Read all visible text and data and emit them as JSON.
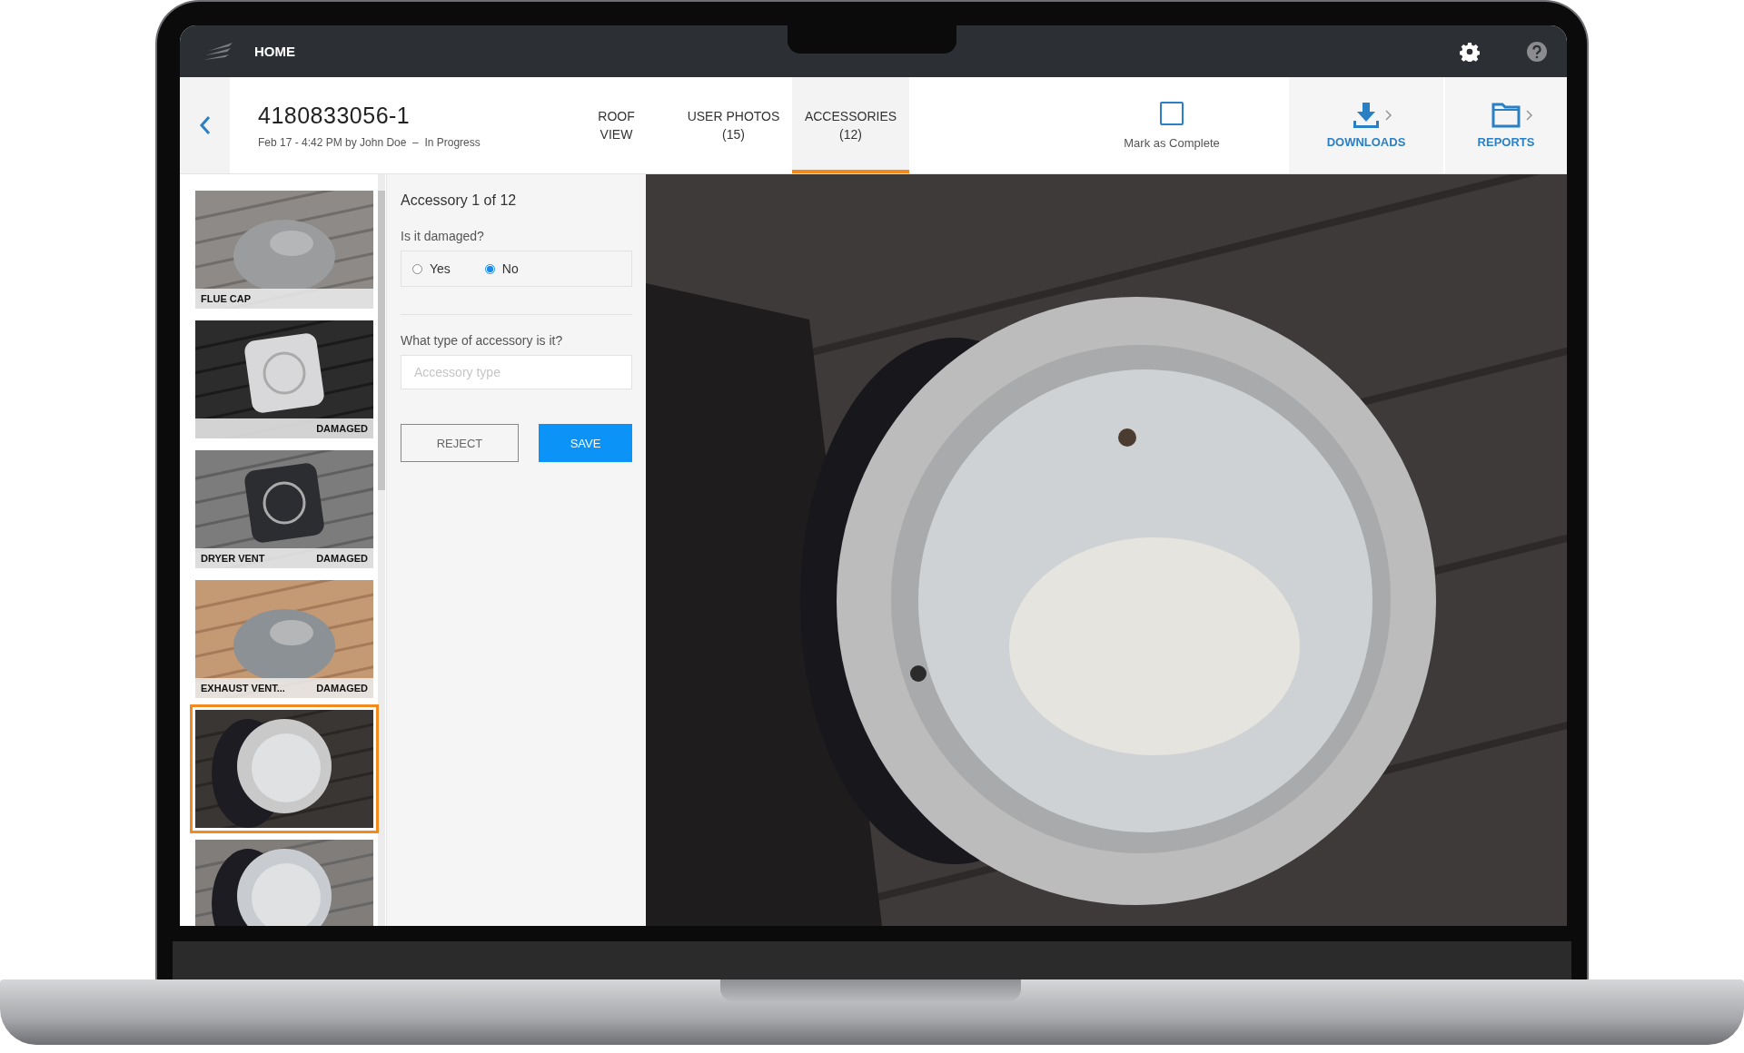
{
  "top_bar": {
    "title": "HOME"
  },
  "header": {
    "title": "4180833056-1",
    "subtitle": "Feb 17 - 4:42 PM by John Doe  –  In Progress",
    "tabs": [
      {
        "label": "ROOF",
        "label2": "VIEW",
        "selected": false
      },
      {
        "label": "USER PHOTOS",
        "label2": "(15)",
        "selected": false
      },
      {
        "label": "ACCESSORIES",
        "label2": "(12)",
        "selected": true
      }
    ],
    "mark_complete": {
      "label": "Mark as Complete",
      "checked": false
    },
    "actions": [
      {
        "label": "DOWNLOADS",
        "kind": "download"
      },
      {
        "label": "REPORTS",
        "kind": "folder"
      }
    ]
  },
  "thumbnails": [
    {
      "label": "FLUE CAP",
      "selected": false,
      "kind": "dome"
    },
    {
      "status": "DAMAGED",
      "selected": false,
      "kind": "square"
    },
    {
      "label": "DRYER VENT",
      "status": "DAMAGED",
      "selected": false,
      "kind": "box"
    },
    {
      "label": "EXHAUST VENT...",
      "status": "DAMAGED",
      "selected": false,
      "kind": "turbine"
    },
    {
      "selected": true,
      "kind": "disc"
    },
    {
      "selected": false,
      "kind": "disc2"
    }
  ],
  "form": {
    "heading": "Accessory 1 of 12",
    "question": "Is it damaged?",
    "options": [
      {
        "label": "Yes",
        "selected": false
      },
      {
        "label": "No",
        "selected": true
      }
    ],
    "type_question": "What type of accessory is it?",
    "type_placeholder": "Accessory type",
    "buttons": [
      {
        "label": "REJECT",
        "kind": "secondary"
      },
      {
        "label": "SAVE",
        "kind": "primary"
      }
    ]
  }
}
